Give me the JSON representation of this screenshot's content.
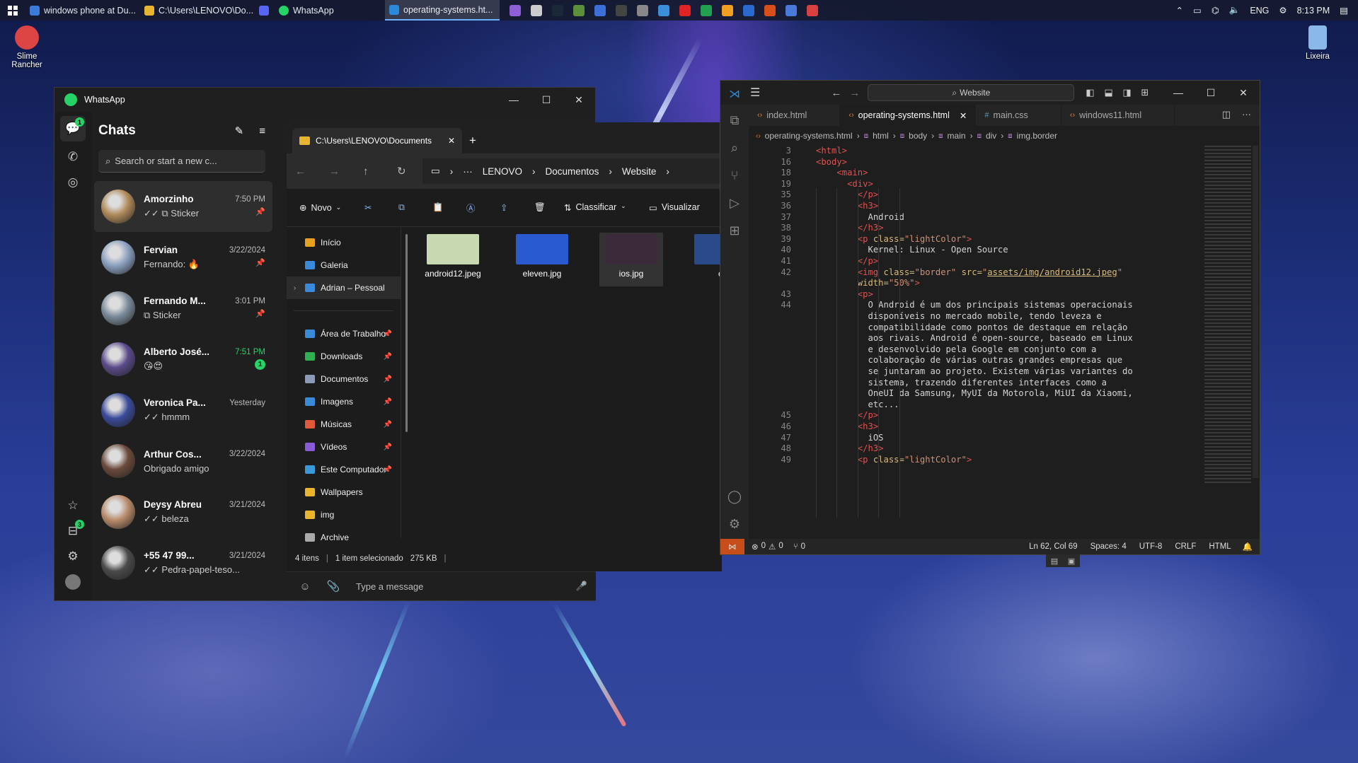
{
  "taskbar": {
    "tasks": [
      {
        "label": "windows phone at Du...",
        "color": "#3d7bd9"
      },
      {
        "label": "C:\\Users\\LENOVO\\Do...",
        "color": "#e8b530"
      },
      {
        "label": "",
        "color": "#5865f2"
      },
      {
        "label": "WhatsApp",
        "color": "#25d366"
      },
      {
        "label": "operating-systems.ht...",
        "color": "#2a8ad9"
      }
    ],
    "pinned_colors": [
      "#8f5fd8",
      "#cccccc",
      "#1b2838",
      "#5d8f3b",
      "#3d6fd9",
      "#444444",
      "#888888",
      "#3b8ed9",
      "#e02424",
      "#22a050",
      "#f0a020",
      "#2a6ad0",
      "#d94f1a",
      "#4a7ad9",
      "#d94040"
    ],
    "tray": {
      "language": "ENG",
      "time": "8:13 PM"
    }
  },
  "desktop": {
    "icons": [
      {
        "label": "Slime Rancher",
        "color": "#d44"
      },
      {
        "label": "Lixeira",
        "color": "#8ab8e8"
      }
    ]
  },
  "whatsapp": {
    "title": "WhatsApp",
    "chats_title": "Chats",
    "search_placeholder": "Search or start a new c...",
    "chat_badge": "1",
    "status_badge": "3",
    "chats": [
      {
        "name": "Amorzinho",
        "time": "7:50 PM",
        "msg": "✓✓ ⧉ Sticker",
        "pinned": true,
        "color": "#b08a5a"
      },
      {
        "name": "Fervian",
        "time": "3/22/2024",
        "msg": "Fernando: 🔥",
        "pinned": true,
        "color": "#8aa0c0"
      },
      {
        "name": "Fernando M...",
        "time": "3:01 PM",
        "msg": "⧉ Sticker",
        "pinned": true,
        "color": "#7a8a9a"
      },
      {
        "name": "Alberto José...",
        "time": "7:51 PM",
        "msg": "😘😍",
        "unread": "1",
        "color": "#5a4a8a"
      },
      {
        "name": "Veronica Pa...",
        "time": "Yesterday",
        "msg": "✓✓ hmmm",
        "color": "#3a4a9a"
      },
      {
        "name": "Arthur Cos...",
        "time": "3/22/2024",
        "msg": "Obrigado amigo",
        "color": "#6a4a3a"
      },
      {
        "name": "Deysy Abreu",
        "time": "3/21/2024",
        "msg": "✓✓ beleza",
        "color": "#b88a6a"
      },
      {
        "name": "+55 47 99...",
        "time": "3/21/2024",
        "msg": "✓✓ Pedra-papel-teso...",
        "color": "#4a4a4a"
      }
    ],
    "message_placeholder": "Type a message"
  },
  "explorer": {
    "tab_title": "C:\\Users\\LENOVO\\Documents",
    "breadcrumb": [
      "LENOVO",
      "Documentos",
      "Website"
    ],
    "toolbar": {
      "new": "Novo",
      "sort": "Classificar",
      "view": "Visualizar"
    },
    "nav_top": [
      {
        "label": "Início",
        "color": "#e8a020"
      },
      {
        "label": "Galeria",
        "color": "#3a8ad9"
      },
      {
        "label": "Adrian – Pessoal",
        "color": "#3a8ad9"
      }
    ],
    "nav_pinned": [
      {
        "label": "Área de Trabalho",
        "color": "#3a8ad9"
      },
      {
        "label": "Downloads",
        "color": "#30b050"
      },
      {
        "label": "Documentos",
        "color": "#8a9ab8"
      },
      {
        "label": "Imagens",
        "color": "#3a8ad9"
      },
      {
        "label": "Músicas",
        "color": "#e05a3a"
      },
      {
        "label": "Vídeos",
        "color": "#8a5ad9"
      },
      {
        "label": "Este Computador",
        "color": "#3a9ad9"
      }
    ],
    "nav_folders": [
      {
        "label": "Wallpapers",
        "color": "#e8b530"
      },
      {
        "label": "img",
        "color": "#e8b530"
      },
      {
        "label": "Archive",
        "color": "#aaaaaa"
      }
    ],
    "files": [
      {
        "name": "android12.jpeg",
        "color": "#c8d8b0"
      },
      {
        "name": "eleven.jpg",
        "color": "#2a5ad0"
      },
      {
        "name": "ios.jpg",
        "color": "#3a2a3a"
      },
      {
        "name": "c",
        "color": "#2a4a8a"
      }
    ],
    "status": {
      "items": "4 itens",
      "selected": "1 item selecionado",
      "size": "275 KB"
    }
  },
  "vscode": {
    "search": "Website",
    "tabs": [
      "index.html",
      "operating-systems.html",
      "main.css",
      "windows11.html"
    ],
    "breadcrumb": [
      "operating-systems.html",
      "html",
      "body",
      "main",
      "div",
      "img.border"
    ],
    "code": [
      {
        "n": "3",
        "indent": 0,
        "parts": [
          [
            "tag",
            "<html>"
          ]
        ]
      },
      {
        "n": "16",
        "indent": 0,
        "parts": [
          [
            "tag",
            "<body>"
          ]
        ]
      },
      {
        "n": "18",
        "indent": 4,
        "parts": [
          [
            "tag",
            "<main>"
          ]
        ]
      },
      {
        "n": "19",
        "indent": 6,
        "parts": [
          [
            "tag",
            "<div>"
          ]
        ]
      },
      {
        "n": "35",
        "indent": 8,
        "parts": [
          [
            "tag",
            "</p>"
          ]
        ]
      },
      {
        "n": "36",
        "indent": 8,
        "parts": [
          [
            "tag",
            "<h3>"
          ]
        ]
      },
      {
        "n": "37",
        "indent": 10,
        "parts": [
          [
            "txt",
            "Android"
          ]
        ]
      },
      {
        "n": "38",
        "indent": 8,
        "parts": [
          [
            "tag",
            "</h3>"
          ]
        ]
      },
      {
        "n": "39",
        "indent": 8,
        "parts": [
          [
            "tag",
            "<p "
          ],
          [
            "attr",
            "class="
          ],
          [
            "str",
            "\"lightColor\""
          ],
          [
            "tag",
            ">"
          ]
        ]
      },
      {
        "n": "40",
        "indent": 10,
        "parts": [
          [
            "txt",
            "Kernel: Linux - Open Source"
          ]
        ]
      },
      {
        "n": "41",
        "indent": 8,
        "parts": [
          [
            "tag",
            "</p>"
          ]
        ]
      },
      {
        "n": "42",
        "indent": 8,
        "parts": [
          [
            "tag",
            "<img "
          ],
          [
            "attr",
            "class="
          ],
          [
            "str",
            "\"border\" "
          ],
          [
            "attr",
            "src="
          ],
          [
            "str",
            "\""
          ],
          [
            "url",
            "assets/img/android12.jpeg"
          ],
          [
            "str",
            "\""
          ]
        ]
      },
      {
        "n": "",
        "indent": 8,
        "parts": [
          [
            "attr",
            "width="
          ],
          [
            "str",
            "\"50%\""
          ],
          [
            "tag",
            ">"
          ]
        ]
      },
      {
        "n": "43",
        "indent": 8,
        "parts": [
          [
            "tag",
            "<p>"
          ]
        ]
      },
      {
        "n": "44",
        "indent": 10,
        "parts": [
          [
            "txt",
            "O Android é um dos principais sistemas operacionais"
          ]
        ]
      },
      {
        "n": "",
        "indent": 10,
        "parts": [
          [
            "txt",
            "disponíveis no mercado mobile, tendo leveza e"
          ]
        ]
      },
      {
        "n": "",
        "indent": 10,
        "parts": [
          [
            "txt",
            "compatibilidade como pontos de destaque em relação"
          ]
        ]
      },
      {
        "n": "",
        "indent": 10,
        "parts": [
          [
            "txt",
            "aos rivais. Android é open-source, baseado em Linux"
          ]
        ]
      },
      {
        "n": "",
        "indent": 10,
        "parts": [
          [
            "txt",
            "e desenvolvido pela Google em conjunto com a"
          ]
        ]
      },
      {
        "n": "",
        "indent": 10,
        "parts": [
          [
            "txt",
            "colaboração de várias outras grandes empresas que"
          ]
        ]
      },
      {
        "n": "",
        "indent": 10,
        "parts": [
          [
            "txt",
            "se juntaram ao projeto. Existem várias variantes do"
          ]
        ]
      },
      {
        "n": "",
        "indent": 10,
        "parts": [
          [
            "txt",
            "sistema, trazendo diferentes interfaces como a"
          ]
        ]
      },
      {
        "n": "",
        "indent": 10,
        "parts": [
          [
            "txt",
            "OneUI da Samsung, MyUI da Motorola, MiUI da Xiaomi,"
          ]
        ]
      },
      {
        "n": "",
        "indent": 10,
        "parts": [
          [
            "txt",
            "etc..."
          ]
        ]
      },
      {
        "n": "45",
        "indent": 8,
        "parts": [
          [
            "tag",
            "</p>"
          ]
        ]
      },
      {
        "n": "46",
        "indent": 8,
        "parts": [
          [
            "tag",
            "<h3>"
          ]
        ]
      },
      {
        "n": "47",
        "indent": 10,
        "parts": [
          [
            "txt",
            "iOS"
          ]
        ]
      },
      {
        "n": "48",
        "indent": 8,
        "parts": [
          [
            "tag",
            "</h3>"
          ]
        ]
      },
      {
        "n": "49",
        "indent": 8,
        "parts": [
          [
            "tag",
            "<p "
          ],
          [
            "attr",
            "class="
          ],
          [
            "str",
            "\"lightColor\""
          ],
          [
            "tag",
            ">"
          ]
        ]
      }
    ],
    "status": {
      "errors": "0",
      "warnings": "0",
      "ports": "0",
      "position": "Ln 62, Col 69",
      "spaces": "Spaces: 4",
      "encoding": "UTF-8",
      "eol": "CRLF",
      "language": "HTML"
    },
    "colors": {
      "accent": "#0078d4",
      "remote": "#c74e1a"
    }
  }
}
